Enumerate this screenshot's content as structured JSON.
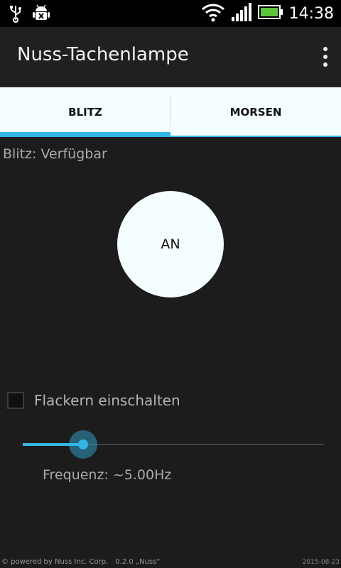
{
  "status_bar": {
    "time": "14:38",
    "icons": [
      "usb-icon",
      "android-debug-icon",
      "wifi-icon",
      "signal-icon",
      "battery-icon"
    ],
    "battery_color": "#5ec43a"
  },
  "app": {
    "title": "Nuss-Tachenlampe"
  },
  "tabs": [
    {
      "label": "BLITZ",
      "active": true
    },
    {
      "label": "MORSEN",
      "active": false
    }
  ],
  "main": {
    "flash_status": "Blitz: Verfügbar",
    "toggle_label": "AN",
    "flicker": {
      "label": "Flackern einschalten",
      "checked": false
    },
    "frequency": {
      "label": "Frequenz:  ~5.00Hz",
      "slider_fraction": 0.2
    }
  },
  "footer": {
    "powered_by": "© powered by Nuss Inc. Corp.",
    "version": "0.2.0 „Nuss“",
    "date": "2015-08-23"
  },
  "colors": {
    "accent": "#33b5e5",
    "background": "#1c1c1c",
    "tab_background": "#f4fefe"
  }
}
